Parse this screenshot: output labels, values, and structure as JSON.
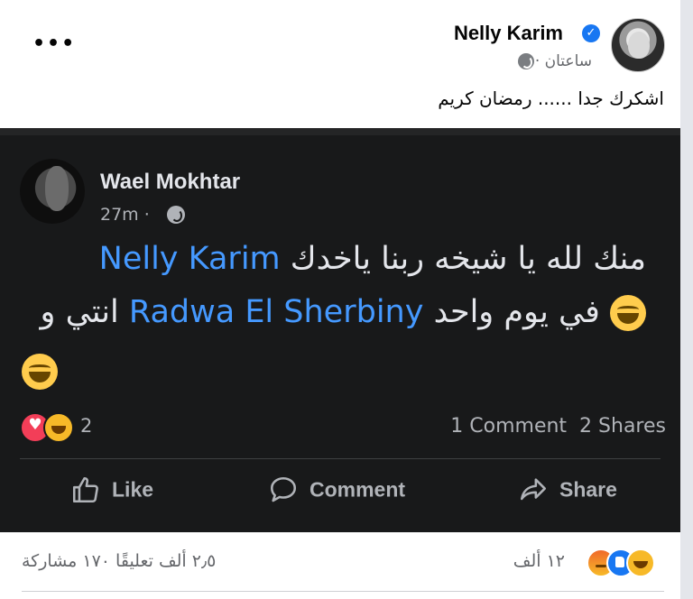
{
  "post": {
    "author": "Nelly Karim",
    "time": "ساعتان ·",
    "caption": "اشكرك جدا ...... رمضان كريم",
    "menu_label": "•••"
  },
  "shared_post": {
    "author": "Wael Mokhtar",
    "time": "27m ·",
    "line1_text": "منك لله يا شيخه ربنا ياخدك ",
    "line1_mention": "Nelly Karim",
    "line2_prefix": "في يوم واحد ",
    "line2_mention": "Radwa El Sherbiny",
    "line2_suffix": " انتي و",
    "reaction_count": "2",
    "comments": "1 Comment",
    "shares": "2 Shares",
    "actions": {
      "like": "Like",
      "comment": "Comment",
      "share": "Share"
    }
  },
  "footer": {
    "reaction_count": "١٢ ألف",
    "stats": "٢٫٥ ألف تعليقًا ١٧٠ مشاركة"
  },
  "icons": {
    "verified": "verified-badge-icon",
    "globe": "globe-icon",
    "emoji": "laughing-tears-emoji-icon"
  },
  "colors": {
    "brand_blue": "#1877f2",
    "mention_blue": "#4599ff",
    "dark_bg": "#18191a"
  }
}
